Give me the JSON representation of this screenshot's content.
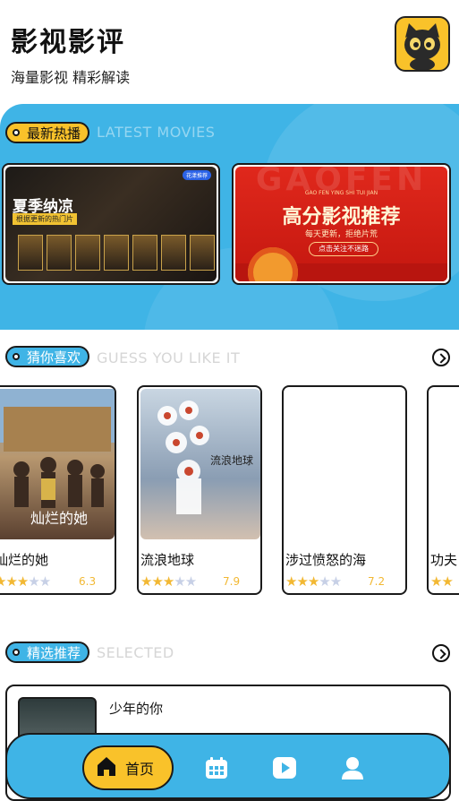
{
  "header": {
    "title": "影视影评",
    "subtitle": "海量影视 精彩解读",
    "logo_icon": "black-cat-mascot-icon"
  },
  "hot": {
    "tag": "最新热播",
    "en": "LATEST MOVIES",
    "banners": [
      {
        "title": "夏季纳凉",
        "subtitle": "根据更新的热门片",
        "badge": "花漾推荐",
        "poster_labels": [
          "SCI",
          "秘密",
          "8",
          "阿尔法"
        ]
      },
      {
        "bg_text": "GAOFEN",
        "pinyin": "GAO FEN YING SHI TUI JIAN",
        "title": "高分影视推荐",
        "subtitle": "每天更新，拒绝片荒",
        "button": "点击关注不迷路"
      }
    ]
  },
  "guess": {
    "tag": "猜你喜欢",
    "en": "GUESS YOU LIKE IT",
    "items": [
      {
        "title": "灿烂的她",
        "rating": "6.3",
        "stars": 3,
        "poster_text": "灿烂的她"
      },
      {
        "title": "流浪地球",
        "rating": "7.9",
        "stars": 3,
        "poster_text": "流浪地球"
      },
      {
        "title": "涉过愤怒的海",
        "rating": "7.2",
        "stars": 3,
        "poster_text": ""
      },
      {
        "title": "功夫",
        "rating": "",
        "stars": 1,
        "poster_text": ""
      }
    ]
  },
  "selected": {
    "tag": "精选推荐",
    "en": "SELECTED",
    "items": [
      {
        "title": "少年的你"
      }
    ]
  },
  "tabbar": {
    "home_label": "首页",
    "icons": [
      "home-icon",
      "calendar-icon",
      "play-icon",
      "user-icon"
    ]
  },
  "colors": {
    "accent_blue": "#3fb4e6",
    "accent_yellow": "#f9c22a",
    "star_on": "#f2b833",
    "star_off": "#c7d0e6"
  }
}
